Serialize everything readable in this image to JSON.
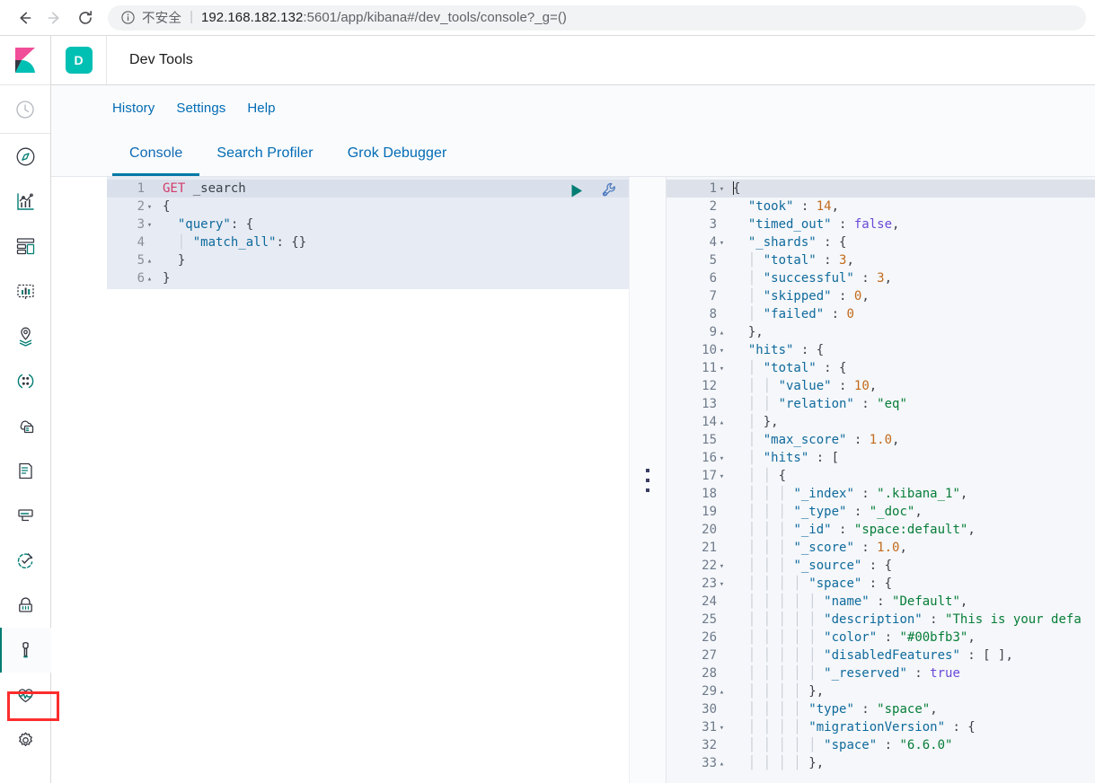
{
  "browser": {
    "back_icon": "arrow-left-icon",
    "forward_icon": "arrow-right-icon",
    "reload_icon": "reload-icon",
    "info_icon": "info-circle-icon",
    "security_label": "不安全",
    "separator": "|",
    "url_host": "192.168.182.132",
    "url_rest": ":5601/app/kibana#/dev_tools/console?_g=()"
  },
  "rail": {
    "logo": "kibana-logo-icon",
    "recent_icon": "recently-viewed-clock-icon",
    "items": [
      {
        "name": "discover",
        "icon": "compass-icon"
      },
      {
        "name": "visualize",
        "icon": "line-chart-icon"
      },
      {
        "name": "dashboard",
        "icon": "dashboard-grid-icon"
      },
      {
        "name": "canvas",
        "icon": "canvas-presentation-icon"
      },
      {
        "name": "maps",
        "icon": "map-marker-layers-icon"
      },
      {
        "name": "machine-learning",
        "icon": "machine-learning-nodes-icon"
      },
      {
        "name": "infrastructure",
        "icon": "infrastructure-cloud-icon"
      },
      {
        "name": "logs",
        "icon": "logs-document-icon"
      },
      {
        "name": "apm",
        "icon": "apm-trace-icon"
      },
      {
        "name": "uptime",
        "icon": "uptime-clock-arrow-icon"
      },
      {
        "name": "siem",
        "icon": "security-lock-icon"
      },
      {
        "name": "dev-tools",
        "icon": "wrench-icon"
      },
      {
        "name": "monitoring",
        "icon": "heartbeat-monitor-icon"
      },
      {
        "name": "management",
        "icon": "gear-icon"
      }
    ],
    "active": "dev-tools",
    "highlight_color": "#fc2d2d"
  },
  "header": {
    "badge_letter": "D",
    "badge_color": "#00bfb3",
    "title": "Dev Tools"
  },
  "subnav": [
    {
      "label": "History"
    },
    {
      "label": "Settings"
    },
    {
      "label": "Help"
    }
  ],
  "tabs": [
    {
      "label": "Console",
      "active": true
    },
    {
      "label": "Search Profiler",
      "active": false
    },
    {
      "label": "Grok Debugger",
      "active": false
    }
  ],
  "editor": {
    "play_icon": "play-triangle-icon",
    "play_color": "#017d73",
    "wrench_icon": "wrench-settings-icon",
    "wrench_color": "#4b79bd",
    "request_text": "GET _search\n{\n  \"query\": {\n    \"match_all\": {}\n  }\n}",
    "lines": [
      {
        "n": "1",
        "fold": "",
        "active": true,
        "tokens": [
          {
            "t": "GET",
            "c": "k-method"
          },
          {
            "t": " _search",
            "c": "k-url"
          }
        ]
      },
      {
        "n": "2",
        "fold": "▾",
        "active": false,
        "tokens": [
          {
            "t": "{",
            "c": "k-punc"
          }
        ]
      },
      {
        "n": "3",
        "fold": "▾",
        "active": false,
        "tokens": [
          {
            "t": "  ",
            "c": "ind"
          },
          {
            "t": "\"query\"",
            "c": "k-key"
          },
          {
            "t": ": {",
            "c": "k-punc"
          }
        ]
      },
      {
        "n": "4",
        "fold": "",
        "active": false,
        "tokens": [
          {
            "t": "  │ ",
            "c": "ind"
          },
          {
            "t": "\"match_all\"",
            "c": "k-key"
          },
          {
            "t": ": {}",
            "c": "k-punc"
          }
        ]
      },
      {
        "n": "5",
        "fold": "▴",
        "active": false,
        "tokens": [
          {
            "t": "  ",
            "c": "ind"
          },
          {
            "t": "}",
            "c": "k-punc"
          }
        ]
      },
      {
        "n": "6",
        "fold": "▴",
        "active": false,
        "tokens": [
          {
            "t": "}",
            "c": "k-punc"
          }
        ]
      }
    ]
  },
  "splitter": {
    "handle_icon": "drag-handle-dots-icon"
  },
  "response": {
    "lines": [
      {
        "n": "1",
        "fold": "▾",
        "active": true,
        "tokens": [
          {
            "t": "",
            "c": "cursor"
          },
          {
            "t": "{",
            "c": "k-punc"
          }
        ]
      },
      {
        "n": "2",
        "fold": "",
        "active": false,
        "tokens": [
          {
            "t": "  ",
            "c": "ind"
          },
          {
            "t": "\"took\"",
            "c": "k-key"
          },
          {
            "t": " : ",
            "c": "k-punc"
          },
          {
            "t": "14",
            "c": "k-num"
          },
          {
            "t": ",",
            "c": "k-punc"
          }
        ]
      },
      {
        "n": "3",
        "fold": "",
        "active": false,
        "tokens": [
          {
            "t": "  ",
            "c": "ind"
          },
          {
            "t": "\"timed_out\"",
            "c": "k-key"
          },
          {
            "t": " : ",
            "c": "k-punc"
          },
          {
            "t": "false",
            "c": "k-bool"
          },
          {
            "t": ",",
            "c": "k-punc"
          }
        ]
      },
      {
        "n": "4",
        "fold": "▾",
        "active": false,
        "tokens": [
          {
            "t": "  ",
            "c": "ind"
          },
          {
            "t": "\"_shards\"",
            "c": "k-key"
          },
          {
            "t": " : {",
            "c": "k-punc"
          }
        ]
      },
      {
        "n": "5",
        "fold": "",
        "active": false,
        "tokens": [
          {
            "t": "  │ ",
            "c": "ind"
          },
          {
            "t": "\"total\"",
            "c": "k-key"
          },
          {
            "t": " : ",
            "c": "k-punc"
          },
          {
            "t": "3",
            "c": "k-num"
          },
          {
            "t": ",",
            "c": "k-punc"
          }
        ]
      },
      {
        "n": "6",
        "fold": "",
        "active": false,
        "tokens": [
          {
            "t": "  │ ",
            "c": "ind"
          },
          {
            "t": "\"successful\"",
            "c": "k-key"
          },
          {
            "t": " : ",
            "c": "k-punc"
          },
          {
            "t": "3",
            "c": "k-num"
          },
          {
            "t": ",",
            "c": "k-punc"
          }
        ]
      },
      {
        "n": "7",
        "fold": "",
        "active": false,
        "tokens": [
          {
            "t": "  │ ",
            "c": "ind"
          },
          {
            "t": "\"skipped\"",
            "c": "k-key"
          },
          {
            "t": " : ",
            "c": "k-punc"
          },
          {
            "t": "0",
            "c": "k-num"
          },
          {
            "t": ",",
            "c": "k-punc"
          }
        ]
      },
      {
        "n": "8",
        "fold": "",
        "active": false,
        "tokens": [
          {
            "t": "  │ ",
            "c": "ind"
          },
          {
            "t": "\"failed\"",
            "c": "k-key"
          },
          {
            "t": " : ",
            "c": "k-punc"
          },
          {
            "t": "0",
            "c": "k-num"
          }
        ]
      },
      {
        "n": "9",
        "fold": "▴",
        "active": false,
        "tokens": [
          {
            "t": "  ",
            "c": "ind"
          },
          {
            "t": "},",
            "c": "k-punc"
          }
        ]
      },
      {
        "n": "10",
        "fold": "▾",
        "active": false,
        "tokens": [
          {
            "t": "  ",
            "c": "ind"
          },
          {
            "t": "\"hits\"",
            "c": "k-key"
          },
          {
            "t": " : {",
            "c": "k-punc"
          }
        ]
      },
      {
        "n": "11",
        "fold": "▾",
        "active": false,
        "tokens": [
          {
            "t": "  │ ",
            "c": "ind"
          },
          {
            "t": "\"total\"",
            "c": "k-key"
          },
          {
            "t": " : {",
            "c": "k-punc"
          }
        ]
      },
      {
        "n": "12",
        "fold": "",
        "active": false,
        "tokens": [
          {
            "t": "  │ │ ",
            "c": "ind"
          },
          {
            "t": "\"value\"",
            "c": "k-key"
          },
          {
            "t": " : ",
            "c": "k-punc"
          },
          {
            "t": "10",
            "c": "k-num"
          },
          {
            "t": ",",
            "c": "k-punc"
          }
        ]
      },
      {
        "n": "13",
        "fold": "",
        "active": false,
        "tokens": [
          {
            "t": "  │ │ ",
            "c": "ind"
          },
          {
            "t": "\"relation\"",
            "c": "k-key"
          },
          {
            "t": " : ",
            "c": "k-punc"
          },
          {
            "t": "\"eq\"",
            "c": "k-str"
          }
        ]
      },
      {
        "n": "14",
        "fold": "▴",
        "active": false,
        "tokens": [
          {
            "t": "  │ ",
            "c": "ind"
          },
          {
            "t": "},",
            "c": "k-punc"
          }
        ]
      },
      {
        "n": "15",
        "fold": "",
        "active": false,
        "tokens": [
          {
            "t": "  │ ",
            "c": "ind"
          },
          {
            "t": "\"max_score\"",
            "c": "k-key"
          },
          {
            "t": " : ",
            "c": "k-punc"
          },
          {
            "t": "1.0",
            "c": "k-num"
          },
          {
            "t": ",",
            "c": "k-punc"
          }
        ]
      },
      {
        "n": "16",
        "fold": "▾",
        "active": false,
        "tokens": [
          {
            "t": "  │ ",
            "c": "ind"
          },
          {
            "t": "\"hits\"",
            "c": "k-key"
          },
          {
            "t": " : [",
            "c": "k-punc"
          }
        ]
      },
      {
        "n": "17",
        "fold": "▾",
        "active": false,
        "tokens": [
          {
            "t": "  │ │ ",
            "c": "ind"
          },
          {
            "t": "{",
            "c": "k-punc"
          }
        ]
      },
      {
        "n": "18",
        "fold": "",
        "active": false,
        "tokens": [
          {
            "t": "  │ │ │ ",
            "c": "ind"
          },
          {
            "t": "\"_index\"",
            "c": "k-key"
          },
          {
            "t": " : ",
            "c": "k-punc"
          },
          {
            "t": "\".kibana_1\"",
            "c": "k-str"
          },
          {
            "t": ",",
            "c": "k-punc"
          }
        ]
      },
      {
        "n": "19",
        "fold": "",
        "active": false,
        "tokens": [
          {
            "t": "  │ │ │ ",
            "c": "ind"
          },
          {
            "t": "\"_type\"",
            "c": "k-key"
          },
          {
            "t": " : ",
            "c": "k-punc"
          },
          {
            "t": "\"_doc\"",
            "c": "k-str"
          },
          {
            "t": ",",
            "c": "k-punc"
          }
        ]
      },
      {
        "n": "20",
        "fold": "",
        "active": false,
        "tokens": [
          {
            "t": "  │ │ │ ",
            "c": "ind"
          },
          {
            "t": "\"_id\"",
            "c": "k-key"
          },
          {
            "t": " : ",
            "c": "k-punc"
          },
          {
            "t": "\"space:default\"",
            "c": "k-str"
          },
          {
            "t": ",",
            "c": "k-punc"
          }
        ]
      },
      {
        "n": "21",
        "fold": "",
        "active": false,
        "tokens": [
          {
            "t": "  │ │ │ ",
            "c": "ind"
          },
          {
            "t": "\"_score\"",
            "c": "k-key"
          },
          {
            "t": " : ",
            "c": "k-punc"
          },
          {
            "t": "1.0",
            "c": "k-num"
          },
          {
            "t": ",",
            "c": "k-punc"
          }
        ]
      },
      {
        "n": "22",
        "fold": "▾",
        "active": false,
        "tokens": [
          {
            "t": "  │ │ │ ",
            "c": "ind"
          },
          {
            "t": "\"_source\"",
            "c": "k-key"
          },
          {
            "t": " : {",
            "c": "k-punc"
          }
        ]
      },
      {
        "n": "23",
        "fold": "▾",
        "active": false,
        "tokens": [
          {
            "t": "  │ │ │ │ ",
            "c": "ind"
          },
          {
            "t": "\"space\"",
            "c": "k-key"
          },
          {
            "t": " : {",
            "c": "k-punc"
          }
        ]
      },
      {
        "n": "24",
        "fold": "",
        "active": false,
        "tokens": [
          {
            "t": "  │ │ │ │ │ ",
            "c": "ind"
          },
          {
            "t": "\"name\"",
            "c": "k-key"
          },
          {
            "t": " : ",
            "c": "k-punc"
          },
          {
            "t": "\"Default\"",
            "c": "k-str"
          },
          {
            "t": ",",
            "c": "k-punc"
          }
        ]
      },
      {
        "n": "25",
        "fold": "",
        "active": false,
        "tokens": [
          {
            "t": "  │ │ │ │ │ ",
            "c": "ind"
          },
          {
            "t": "\"description\"",
            "c": "k-key"
          },
          {
            "t": " : ",
            "c": "k-punc"
          },
          {
            "t": "\"This is your defa",
            "c": "k-str"
          }
        ]
      },
      {
        "n": "26",
        "fold": "",
        "active": false,
        "tokens": [
          {
            "t": "  │ │ │ │ │ ",
            "c": "ind"
          },
          {
            "t": "\"color\"",
            "c": "k-key"
          },
          {
            "t": " : ",
            "c": "k-punc"
          },
          {
            "t": "\"#00bfb3\"",
            "c": "k-str"
          },
          {
            "t": ",",
            "c": "k-punc"
          }
        ]
      },
      {
        "n": "27",
        "fold": "",
        "active": false,
        "tokens": [
          {
            "t": "  │ │ │ │ │ ",
            "c": "ind"
          },
          {
            "t": "\"disabledFeatures\"",
            "c": "k-key"
          },
          {
            "t": " : [ ],",
            "c": "k-punc"
          }
        ]
      },
      {
        "n": "28",
        "fold": "",
        "active": false,
        "tokens": [
          {
            "t": "  │ │ │ │ │ ",
            "c": "ind"
          },
          {
            "t": "\"_reserved\"",
            "c": "k-key"
          },
          {
            "t": " : ",
            "c": "k-punc"
          },
          {
            "t": "true",
            "c": "k-bool"
          }
        ]
      },
      {
        "n": "29",
        "fold": "▴",
        "active": false,
        "tokens": [
          {
            "t": "  │ │ │ │ ",
            "c": "ind"
          },
          {
            "t": "},",
            "c": "k-punc"
          }
        ]
      },
      {
        "n": "30",
        "fold": "",
        "active": false,
        "tokens": [
          {
            "t": "  │ │ │ │ ",
            "c": "ind"
          },
          {
            "t": "\"type\"",
            "c": "k-key"
          },
          {
            "t": " : ",
            "c": "k-punc"
          },
          {
            "t": "\"space\"",
            "c": "k-str"
          },
          {
            "t": ",",
            "c": "k-punc"
          }
        ]
      },
      {
        "n": "31",
        "fold": "▾",
        "active": false,
        "tokens": [
          {
            "t": "  │ │ │ │ ",
            "c": "ind"
          },
          {
            "t": "\"migrationVersion\"",
            "c": "k-key"
          },
          {
            "t": " : {",
            "c": "k-punc"
          }
        ]
      },
      {
        "n": "32",
        "fold": "",
        "active": false,
        "tokens": [
          {
            "t": "  │ │ │ │ │ ",
            "c": "ind"
          },
          {
            "t": "\"space\"",
            "c": "k-key"
          },
          {
            "t": " : ",
            "c": "k-punc"
          },
          {
            "t": "\"6.6.0\"",
            "c": "k-str"
          }
        ]
      },
      {
        "n": "33",
        "fold": "▴",
        "active": false,
        "tokens": [
          {
            "t": "  │ │ │ │ ",
            "c": "ind"
          },
          {
            "t": "},",
            "c": "k-punc"
          }
        ]
      }
    ]
  }
}
